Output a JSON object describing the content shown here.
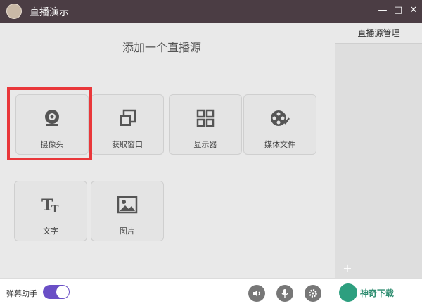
{
  "window": {
    "title": "直播演示",
    "controls": {
      "minimize": "—",
      "maximize": "□",
      "close": "✕"
    }
  },
  "main": {
    "heading": "添加一个直播源",
    "tiles": [
      {
        "label": "摄像头",
        "icon": "webcam-icon"
      },
      {
        "label": "获取窗口",
        "icon": "window-capture-icon"
      },
      {
        "label": "显示器",
        "icon": "grid-display-icon"
      },
      {
        "label": "媒体文件",
        "icon": "film-reel-icon"
      },
      {
        "label": "文字",
        "icon": "text-icon"
      },
      {
        "label": "图片",
        "icon": "image-icon"
      }
    ]
  },
  "sidebar": {
    "title": "直播源管理",
    "add": "+",
    "remove": "−"
  },
  "bottombar": {
    "danmaku_label": "弹幕助手",
    "brand_text": "神奇下载"
  },
  "colors": {
    "titlebar": "#4b3d44",
    "accent": "#6a4fc6",
    "highlight": "#e9373a"
  }
}
